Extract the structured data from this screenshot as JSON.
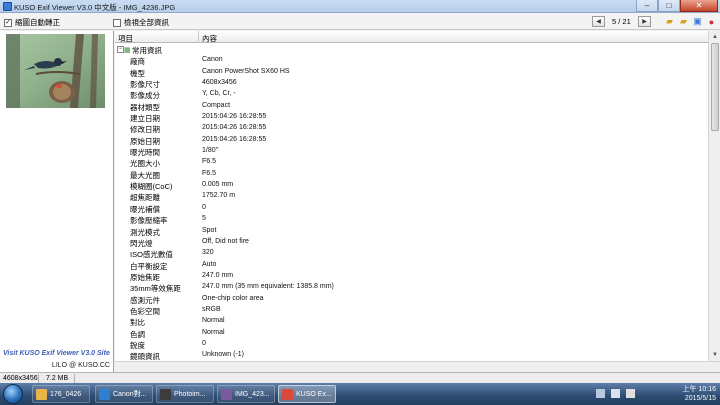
{
  "window": {
    "title": "KUSO Exif Viewer V3.0 中文版 - IMG_4236.JPG"
  },
  "toolbar": {
    "auto_rotate_label": "縮圖自動轉正",
    "auto_rotate_checked": "✓",
    "show_all_label": "檢視全部資訊",
    "page_counter": "5 / 21"
  },
  "left_pane": {
    "site_link": "Visit KUSO Exif Viewer V3.0 Site",
    "credit": "LILO @ KUSO.CC"
  },
  "grid": {
    "headers": {
      "item": "項目",
      "content": "內容"
    },
    "group": {
      "label": "常用資訊",
      "expander": "−"
    },
    "rows": [
      {
        "k": "廠商",
        "v": "Canon"
      },
      {
        "k": "機型",
        "v": "Canon PowerShot SX60 HS"
      },
      {
        "k": "影像尺寸",
        "v": "4608x3456"
      },
      {
        "k": "影像成分",
        "v": "Y, Cb, Cr, -"
      },
      {
        "k": "器材類型",
        "v": "Compact"
      },
      {
        "k": "建立日期",
        "v": "2015:04:26 16:28:55"
      },
      {
        "k": "修改日期",
        "v": "2015:04:26 16:28:55"
      },
      {
        "k": "原始日期",
        "v": "2015:04:26 16:28:55"
      },
      {
        "k": "曝光時間",
        "v": "1/80\""
      },
      {
        "k": "光圈大小",
        "v": "F6.5"
      },
      {
        "k": "最大光圈",
        "v": "F6.5"
      },
      {
        "k": "模糊圈(CoC)",
        "v": "0.005 mm"
      },
      {
        "k": "超焦距離",
        "v": "1752.70 m"
      },
      {
        "k": "曝光補償",
        "v": "0"
      },
      {
        "k": "影像壓縮率",
        "v": "5"
      },
      {
        "k": "測光模式",
        "v": "Spot"
      },
      {
        "k": "閃光燈",
        "v": "Off, Did not fire"
      },
      {
        "k": "ISO感光數值",
        "v": "320"
      },
      {
        "k": "白平衡設定",
        "v": "Auto"
      },
      {
        "k": "原始焦距",
        "v": "247.0 mm"
      },
      {
        "k": "35mm等效焦距",
        "v": "247.0 mm (35 mm equivalent: 1385.8 mm)"
      },
      {
        "k": "感測元件",
        "v": "One-chip color area"
      },
      {
        "k": "色彩空間",
        "v": "sRGB"
      },
      {
        "k": "對比",
        "v": "Normal"
      },
      {
        "k": "色調",
        "v": "Normal"
      },
      {
        "k": "銳度",
        "v": "0"
      },
      {
        "k": "鏡頭資訊",
        "v": "Unknown (-1)"
      }
    ]
  },
  "status": {
    "dimensions": "4608x3456",
    "filesize": "7.2 MB"
  },
  "taskbar": {
    "items": [
      {
        "label": "176_0426",
        "color": "#e8b54a"
      },
      {
        "label": "Canon對...",
        "color": "#2f7fd1"
      },
      {
        "label": "Photoim...",
        "color": "#3c3c3c"
      },
      {
        "label": "IMG_423...",
        "color": "#7a5c9e"
      },
      {
        "label": "KUSO Ex...",
        "color": "#d94a3a"
      }
    ],
    "clock_time": "上午 10:16",
    "clock_date": "2015/5/15"
  },
  "colors": {
    "accent": "#3d5fb5",
    "taskbar": "#2e4b72",
    "title_bar": "#c9dcf2"
  }
}
